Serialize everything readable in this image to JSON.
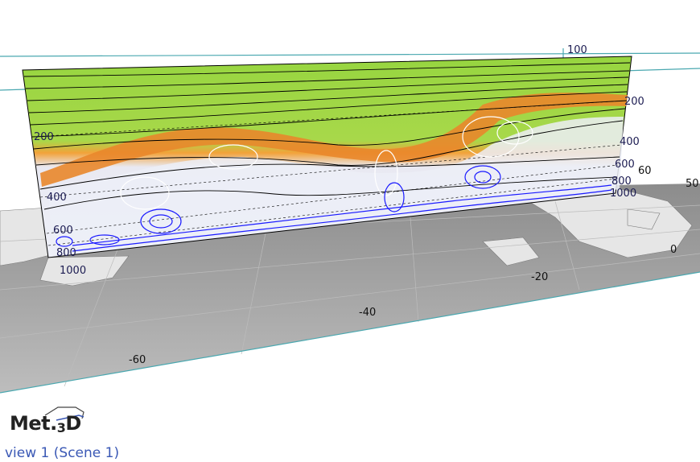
{
  "section": {
    "pressure_labels_left": [
      "200",
      "400",
      "600",
      "800",
      "1000"
    ],
    "pressure_labels_right": [
      "100",
      "200",
      "400",
      "600",
      "800",
      "1000"
    ]
  },
  "map": {
    "longitude_labels": [
      "-60",
      "-40",
      "-20",
      "0"
    ],
    "latitude_labels": [
      "60",
      "50"
    ]
  },
  "branding": {
    "logo_text": "Met.",
    "logo_sub": "3",
    "logo_suffix": "D"
  },
  "view": {
    "label": "view 1 (Scene 1)"
  },
  "colors": {
    "stratosphere": "#8fd43a",
    "tropopause": "#e0822a",
    "contour_blue": "#1a1aff",
    "contour_white": "#ffffff",
    "frame_line": "#4aa8b0",
    "label_text": "#1c1c52"
  }
}
